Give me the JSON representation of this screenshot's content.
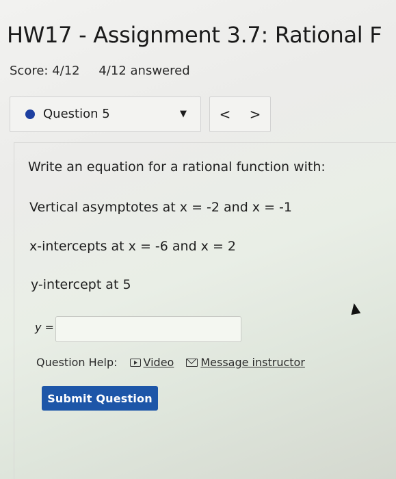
{
  "header": {
    "title": "HW17 - Assignment 3.7: Rational F",
    "score": "Score: 4/12",
    "answered": "4/12 answered"
  },
  "question_nav": {
    "current": "Question 5",
    "caret": "▼",
    "prev": "<",
    "next": ">"
  },
  "question": {
    "prompt": "Write an equation for a rational function with:",
    "conditions": [
      "Vertical asymptotes at x = -2 and x = -1",
      "x-intercepts at x = -6 and x = 2",
      "y-intercept at 5"
    ],
    "answer_label": "y =",
    "answer_value": ""
  },
  "help": {
    "label": "Question Help:",
    "video": "Video",
    "message": "Message instructor"
  },
  "submit_label": "Submit Question",
  "colors": {
    "accent": "#1d56a8",
    "dot": "#1d3fa0"
  }
}
